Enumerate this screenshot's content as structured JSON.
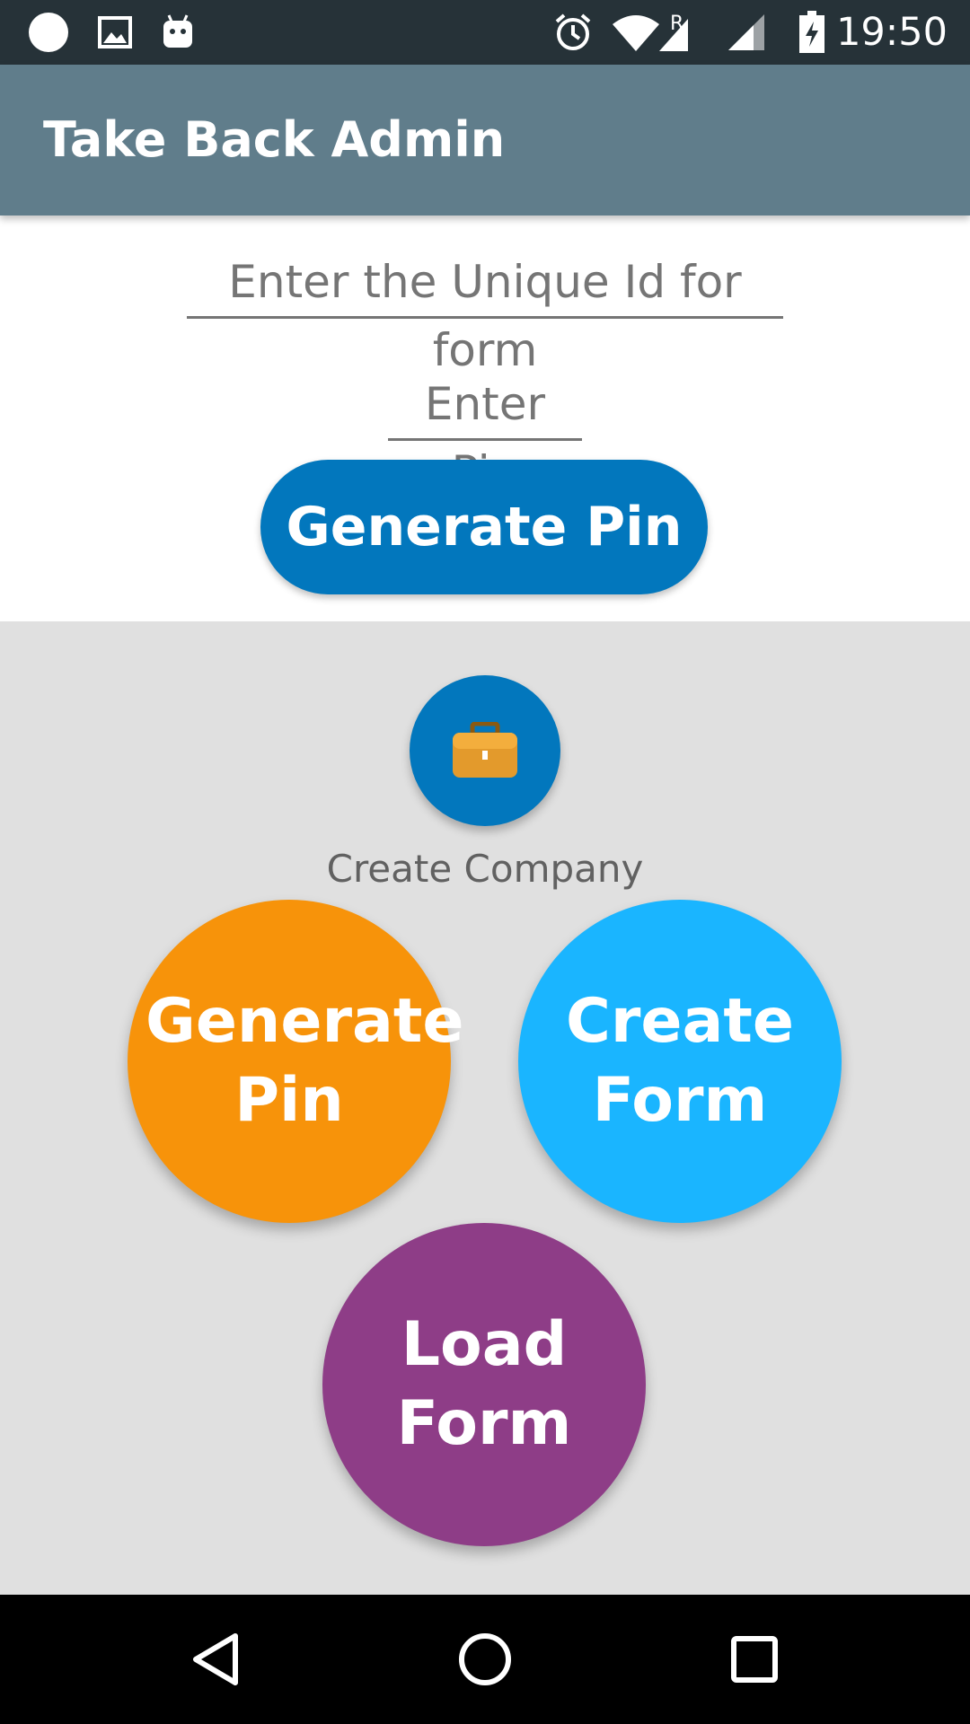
{
  "status_bar": {
    "time": "19:50",
    "icons": [
      "circle-notification-icon",
      "image-icon",
      "android-icon",
      "alarm-icon",
      "wifi-icon",
      "cell-signal-icon",
      "battery-charging-icon"
    ],
    "roaming_letter": "R"
  },
  "app_bar": {
    "title": "Take Back Admin",
    "color": "#607D8B"
  },
  "form": {
    "unique_id_placeholder": "Enter the Unique Id for form",
    "unique_id_value": "",
    "pin_placeholder": "Enter Pin",
    "pin_value": "",
    "generate_button_label": "Generate Pin",
    "button_color": "#0277BD"
  },
  "actions": {
    "company_icon": "briefcase-icon",
    "company_label": "Create Company",
    "generate_pin_label_line1": "Generate",
    "generate_pin_label_line2": "Pin",
    "create_form_label_line1": "Create",
    "create_form_label_line2": "Form",
    "load_form_label_line1": "Load",
    "load_form_label_line2": "Form",
    "colors": {
      "generate_pin": "#F7930A",
      "create_form": "#1AB5FF",
      "load_form": "#8E3D87"
    }
  },
  "nav_bar": {
    "icons": [
      "back-icon",
      "home-icon",
      "recents-icon"
    ]
  }
}
